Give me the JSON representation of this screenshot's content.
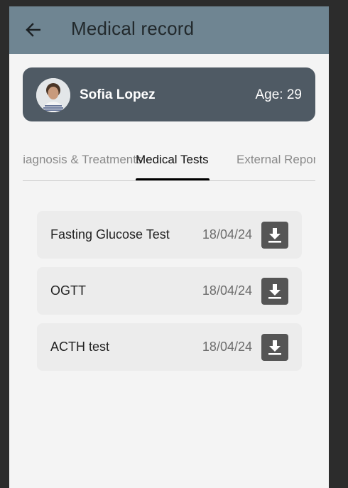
{
  "appbar": {
    "title": "Medical record",
    "back_icon": "arrow-left-icon"
  },
  "patient": {
    "name": "Sofia Lopez",
    "age_text": "Age: 29"
  },
  "tabs": [
    {
      "label": "Diagnosis & Treatments",
      "active": false
    },
    {
      "label": "Medical Tests",
      "active": true
    },
    {
      "label": "External Reports",
      "active": false
    }
  ],
  "tests": [
    {
      "name": "Fasting Glucose Test",
      "date": "18/04/24",
      "icon": "download-icon"
    },
    {
      "name": "OGTT",
      "date": "18/04/24",
      "icon": "download-icon"
    },
    {
      "name": "ACTH test",
      "date": "18/04/24",
      "icon": "download-icon"
    }
  ],
  "colors": {
    "appbar": "#6f8592",
    "profile_card": "#4f5a64",
    "background": "#f4f4f4",
    "list_item": "#ececec",
    "download_button": "#555555"
  }
}
